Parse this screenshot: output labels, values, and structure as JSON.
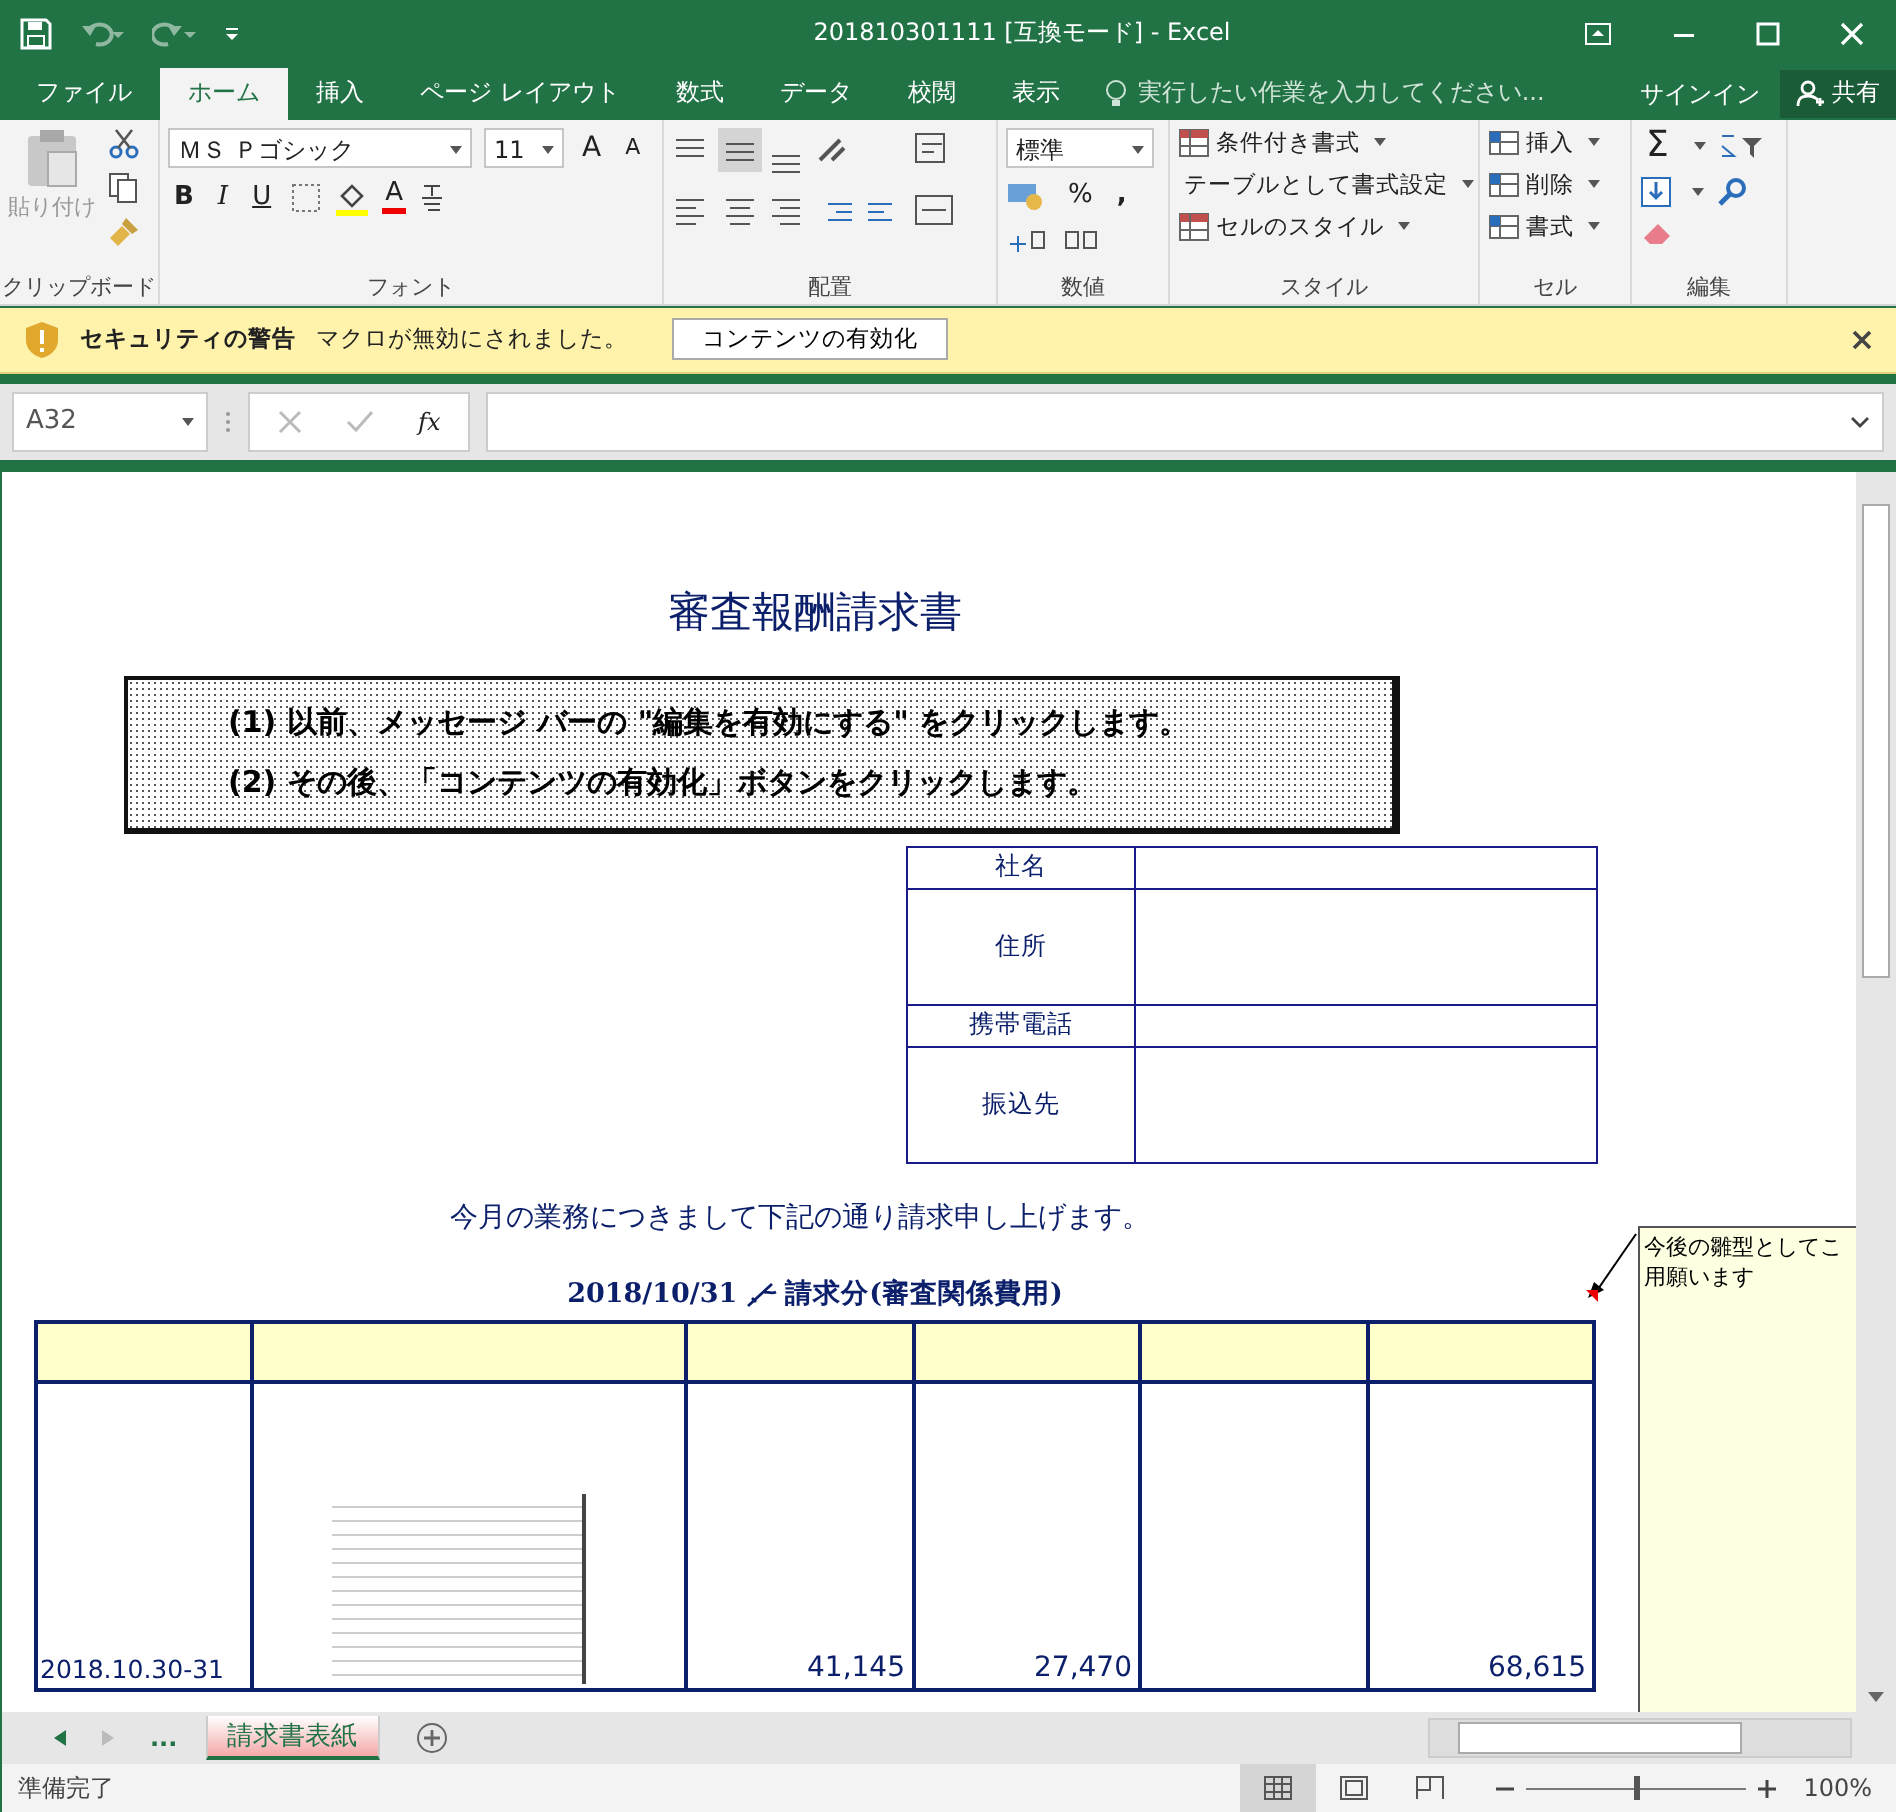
{
  "title_bar": {
    "title": "201810301111  [互換モード] - Excel"
  },
  "menu_tabs": [
    {
      "label": "ファイル",
      "selected": false
    },
    {
      "label": "ホーム",
      "selected": true
    },
    {
      "label": "挿入",
      "selected": false
    },
    {
      "label": "ページ レイアウト",
      "selected": false
    },
    {
      "label": "数式",
      "selected": false
    },
    {
      "label": "データ",
      "selected": false
    },
    {
      "label": "校閲",
      "selected": false
    },
    {
      "label": "表示",
      "selected": false
    }
  ],
  "tell_me": {
    "placeholder": "実行したい作業を入力してください..."
  },
  "account": {
    "sign_in": "サインイン",
    "share": "共有"
  },
  "ribbon": {
    "clipboard": {
      "paste": "貼り付け",
      "label": "クリップボード"
    },
    "font": {
      "name": "ＭＳ Ｐゴシック",
      "size": "11",
      "grow": "A",
      "shrink": "A",
      "bold": "B",
      "italic": "I",
      "underline": "U",
      "font_color": "A",
      "label": "フォント"
    },
    "alignment": {
      "label": "配置"
    },
    "number": {
      "format": "標準",
      "percent": "%",
      "comma": ",",
      "label": "数値"
    },
    "styles": {
      "buttons": [
        "条件付き書式",
        "テーブルとして書式設定",
        "セルのスタイル"
      ],
      "label": "スタイル"
    },
    "cells": {
      "buttons": [
        "挿入",
        "削除",
        "書式"
      ],
      "label": "セル"
    },
    "editing": {
      "sum": "Σ",
      "label": "編集"
    }
  },
  "security_bar": {
    "title": "セキュリティの警告",
    "message": "マクロが無効にされました。",
    "button": "コンテンツの有効化"
  },
  "formula_bar": {
    "name_box": "A32",
    "fx": "fx"
  },
  "sheet": {
    "title": "審査報酬請求書",
    "instructions": [
      "(1) 以前、メッセージ バーの \"編集を有効にする\" をクリックします。",
      "(2) その後、「コンテンツの有効化」ボタンをクリックします。"
    ],
    "info_table": [
      {
        "label": "社名",
        "kind": "short"
      },
      {
        "label": "住所",
        "kind": "tall"
      },
      {
        "label": "携帯電話",
        "kind": "short"
      },
      {
        "label": "振込先",
        "kind": "tall"
      }
    ],
    "intro": "今月の業務につきまして下記の通り請求申し上げます。",
    "heading": {
      "date": "2018/10/31",
      "text": "請求分(審査関係費用)"
    },
    "invoice_row": [
      "2018.10.30-31",
      "41,145",
      "27,470",
      "68,615"
    ],
    "comment": [
      "今後の雛型としてこ",
      "用願います"
    ]
  },
  "sheet_tabs": {
    "more": "...",
    "tabs": [
      {
        "label": "請求書表紙",
        "selected": true
      }
    ]
  },
  "status_bar": {
    "status": "準備完了",
    "views": [
      {
        "kind": "normal",
        "selected": true
      },
      {
        "kind": "layout",
        "selected": false
      },
      {
        "kind": "pagebreak",
        "selected": false
      }
    ],
    "zoom_slider": {
      "level": 0.5
    },
    "zoom": "100%"
  }
}
